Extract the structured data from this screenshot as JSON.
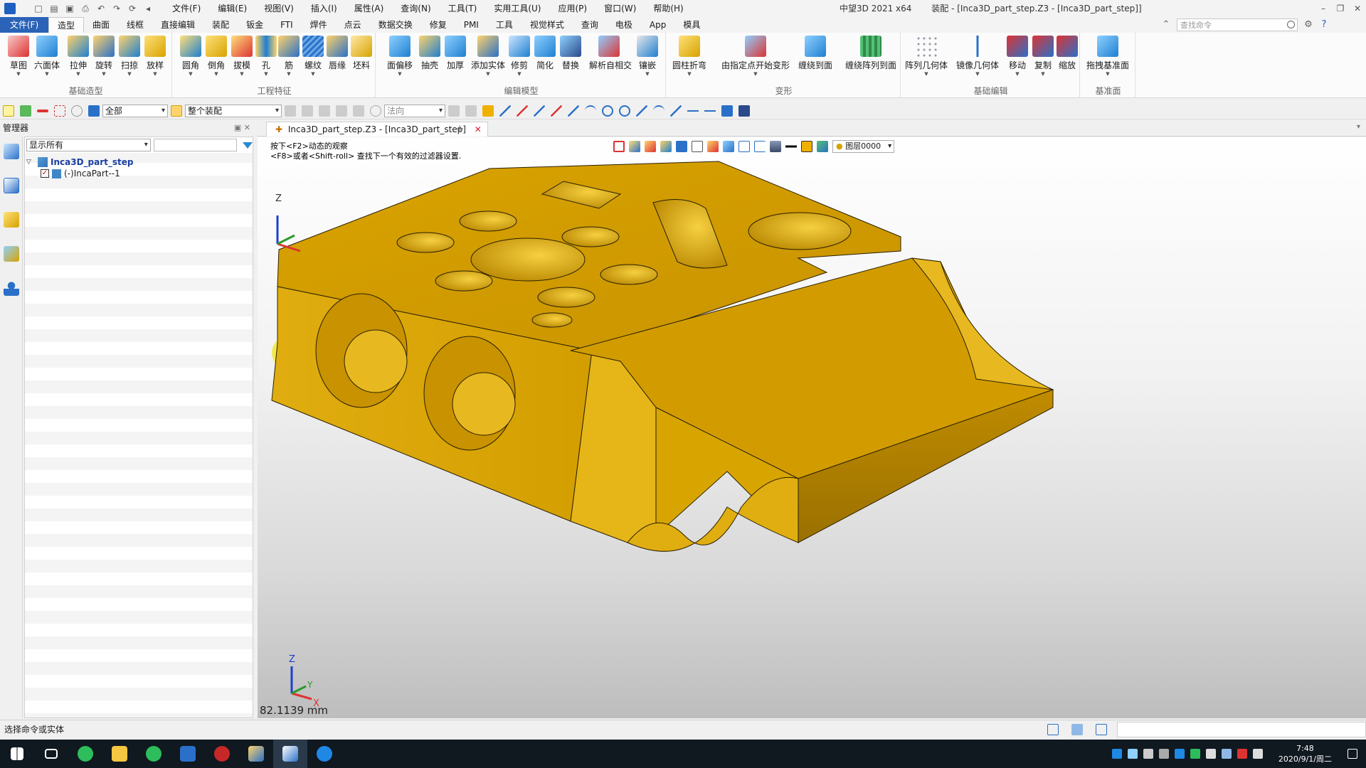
{
  "titlebar": {
    "menus": [
      "文件(F)",
      "编辑(E)",
      "视图(V)",
      "插入(I)",
      "属性(A)",
      "查询(N)",
      "工具(T)",
      "实用工具(U)",
      "应用(P)",
      "窗口(W)",
      "帮助(H)"
    ],
    "app_name": "中望3D 2021 x64",
    "document_title": "装配 - [Inca3D_part_step.Z3 - [Inca3D_part_step]]"
  },
  "ribbon_tabs": {
    "file": "文件(F)",
    "tabs": [
      "造型",
      "曲面",
      "线框",
      "直接编辑",
      "装配",
      "钣金",
      "FTI",
      "焊件",
      "点云",
      "数据交换",
      "修复",
      "PMI",
      "工具",
      "视觉样式",
      "查询",
      "电极",
      "App",
      "模具"
    ],
    "active": "造型",
    "search_placeholder": "查找命令"
  },
  "ribbon": {
    "groups": [
      {
        "label": "基础造型",
        "buttons": [
          "草图",
          "六面体",
          "拉伸",
          "旋转",
          "扫掠",
          "放样"
        ]
      },
      {
        "label": "工程特征",
        "buttons": [
          "圆角",
          "倒角",
          "拔模",
          "孔",
          "筋",
          "螺纹",
          "唇缘",
          "坯料"
        ]
      },
      {
        "label": "编辑模型",
        "buttons": [
          "面偏移",
          "抽壳",
          "加厚",
          "添加实体",
          "修剪",
          "简化",
          "替换",
          "解析自相交",
          "镶嵌"
        ]
      },
      {
        "label": "变形",
        "buttons": [
          "圆柱折弯",
          "由指定点开始变形",
          "缠绕到面",
          "缠绕阵列到面"
        ]
      },
      {
        "label": "基础编辑",
        "buttons": [
          "阵列几何体",
          "镜像几何体",
          "移动",
          "复制",
          "缩放"
        ]
      },
      {
        "label": "基准面",
        "buttons": [
          "拖拽基准面"
        ]
      }
    ]
  },
  "toolrow": {
    "filter_value": "全部",
    "assembly_value": "整个装配",
    "direction_value": "法向"
  },
  "manager": {
    "title": "管理器",
    "filter_value": "显示所有",
    "tree": [
      {
        "label": "Inca3D_part_step",
        "level": 0
      },
      {
        "label": "(-)IncaPart--1",
        "level": 1
      }
    ]
  },
  "document": {
    "tab_label": "Inca3D_part_step.Z3 - [Inca3D_part_step]",
    "hint_line1": "按下<F2>动态的观察",
    "hint_line2": "<F8>或者<Shift-roll> 查找下一个有效的过滤器设置.",
    "layer": "图层0000",
    "measure": "82.1139 mm",
    "axis_labels": {
      "z": "Z",
      "y": "Y",
      "x": "X"
    }
  },
  "statusbar": {
    "prompt": "选择命令或实体"
  },
  "taskbar": {
    "time": "7:48",
    "date": "2020/9/1/周二"
  },
  "colors": {
    "part_face": "#d7a300",
    "part_dark": "#a87c00",
    "file_tab": "#2a63b8"
  }
}
